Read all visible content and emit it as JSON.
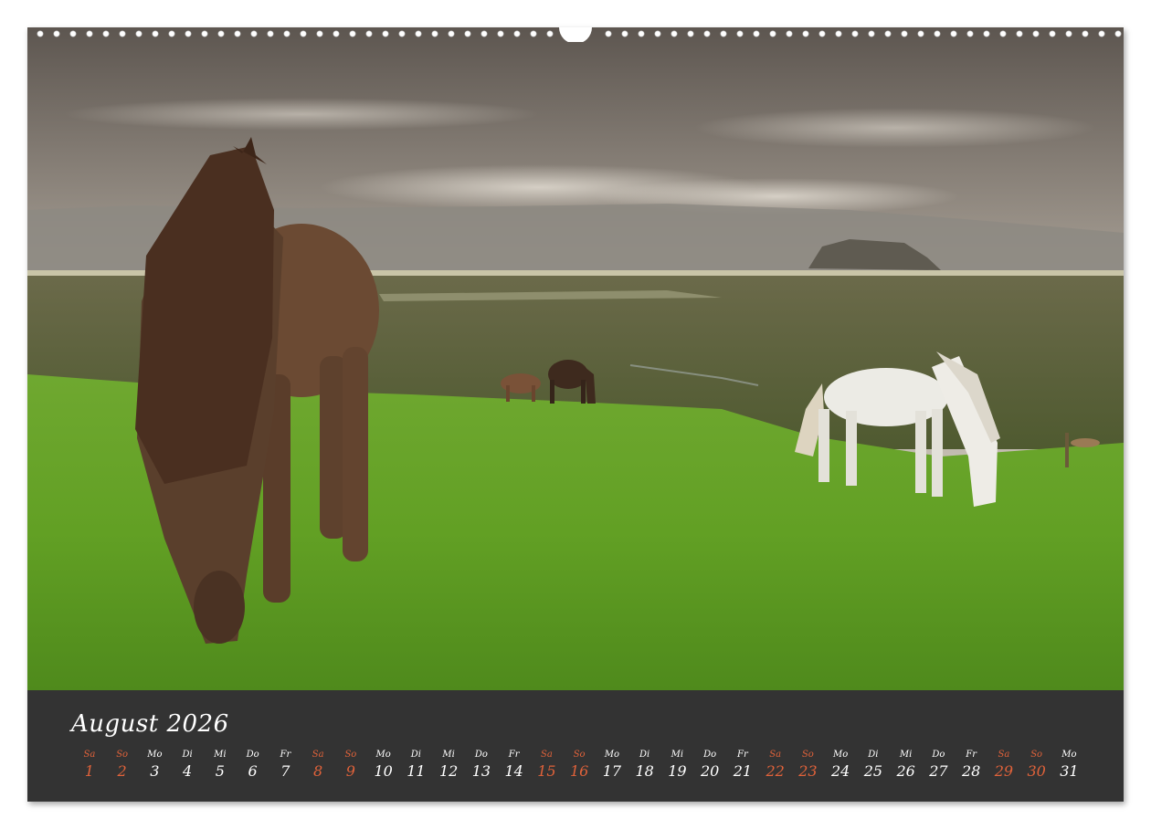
{
  "calendar": {
    "month_title": "August 2026",
    "days": [
      {
        "dow": "Sa",
        "num": "1",
        "weekend": true
      },
      {
        "dow": "So",
        "num": "2",
        "weekend": true
      },
      {
        "dow": "Mo",
        "num": "3",
        "weekend": false
      },
      {
        "dow": "Di",
        "num": "4",
        "weekend": false
      },
      {
        "dow": "Mi",
        "num": "5",
        "weekend": false
      },
      {
        "dow": "Do",
        "num": "6",
        "weekend": false
      },
      {
        "dow": "Fr",
        "num": "7",
        "weekend": false
      },
      {
        "dow": "Sa",
        "num": "8",
        "weekend": true
      },
      {
        "dow": "So",
        "num": "9",
        "weekend": true
      },
      {
        "dow": "Mo",
        "num": "10",
        "weekend": false
      },
      {
        "dow": "Di",
        "num": "11",
        "weekend": false
      },
      {
        "dow": "Mi",
        "num": "12",
        "weekend": false
      },
      {
        "dow": "Do",
        "num": "13",
        "weekend": false
      },
      {
        "dow": "Fr",
        "num": "14",
        "weekend": false
      },
      {
        "dow": "Sa",
        "num": "15",
        "weekend": true
      },
      {
        "dow": "So",
        "num": "16",
        "weekend": true
      },
      {
        "dow": "Mo",
        "num": "17",
        "weekend": false
      },
      {
        "dow": "Di",
        "num": "18",
        "weekend": false
      },
      {
        "dow": "Mi",
        "num": "19",
        "weekend": false
      },
      {
        "dow": "Do",
        "num": "20",
        "weekend": false
      },
      {
        "dow": "Fr",
        "num": "21",
        "weekend": false
      },
      {
        "dow": "Sa",
        "num": "22",
        "weekend": true
      },
      {
        "dow": "So",
        "num": "23",
        "weekend": true
      },
      {
        "dow": "Mo",
        "num": "24",
        "weekend": false
      },
      {
        "dow": "Di",
        "num": "25",
        "weekend": false
      },
      {
        "dow": "Mi",
        "num": "26",
        "weekend": false
      },
      {
        "dow": "Do",
        "num": "27",
        "weekend": false
      },
      {
        "dow": "Fr",
        "num": "28",
        "weekend": false
      },
      {
        "dow": "Sa",
        "num": "29",
        "weekend": true
      },
      {
        "dow": "So",
        "num": "30",
        "weekend": true
      },
      {
        "dow": "Mo",
        "num": "31",
        "weekend": false
      }
    ]
  },
  "colors": {
    "strip_background": "#333333",
    "weekday_text": "#ffffff",
    "weekend_text": "#e0623a"
  },
  "photo": {
    "subject": "icelandic-horses-grazing"
  }
}
